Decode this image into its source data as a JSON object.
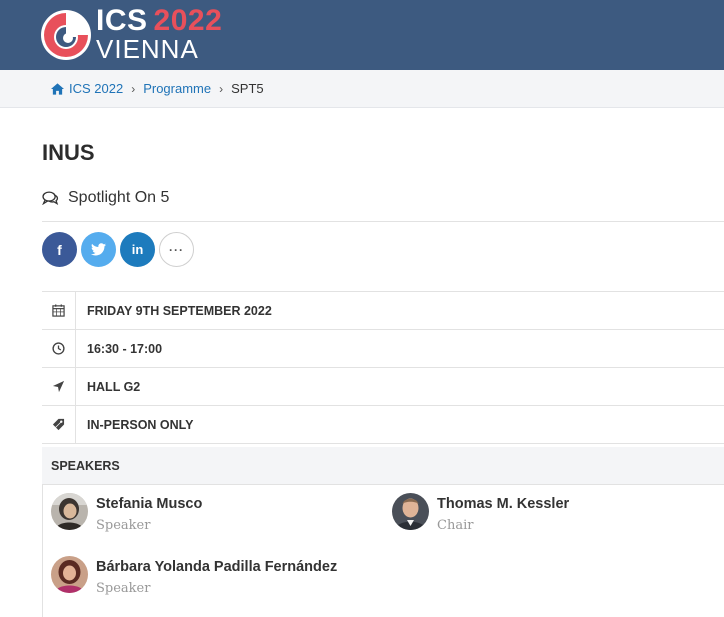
{
  "header": {
    "logo_ics": "ICS",
    "logo_year": "2022",
    "logo_city": "VIENNA"
  },
  "breadcrumb": {
    "items": [
      "ICS 2022",
      "Programme",
      "SPT5"
    ],
    "separator": "›"
  },
  "page": {
    "title": "INUS",
    "session_type": "Spotlight On 5"
  },
  "social": {
    "facebook": "f",
    "twitter": "t",
    "linkedin": "in",
    "more": "···"
  },
  "details": [
    {
      "icon": "calendar-icon",
      "text": "FRIDAY 9TH SEPTEMBER 2022"
    },
    {
      "icon": "clock-icon",
      "text": "16:30 - 17:00"
    },
    {
      "icon": "location-arrow-icon",
      "text": "HALL G2"
    },
    {
      "icon": "tag-icon",
      "text": "IN-PERSON ONLY"
    }
  ],
  "speakers_heading": "SPEAKERS",
  "speakers": [
    {
      "name": "Stefania Musco",
      "role": "Speaker"
    },
    {
      "name": "Thomas M. Kessler",
      "role": "Chair"
    },
    {
      "name": "Bárbara Yolanda Padilla Fernández",
      "role": "Speaker"
    }
  ],
  "colors": {
    "header_bg": "#3d5a80",
    "accent_red": "#e8505b",
    "link": "#1f73b7"
  }
}
